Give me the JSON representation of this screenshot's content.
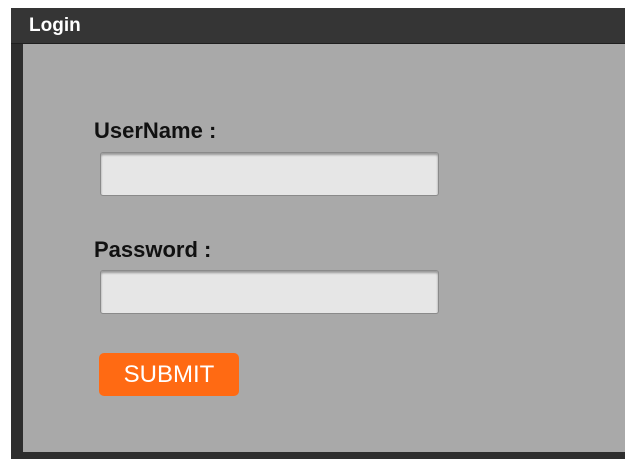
{
  "window": {
    "title": "Login"
  },
  "form": {
    "username_label": "UserName :",
    "username_value": "",
    "password_label": "Password :",
    "password_value": "",
    "submit_label": "SUBMIT"
  },
  "colors": {
    "title_bar": "#353535",
    "panel": "#a9a9a9",
    "input_bg": "#e6e6e6",
    "submit_bg": "#ff6a13",
    "submit_text": "#ffffff"
  }
}
